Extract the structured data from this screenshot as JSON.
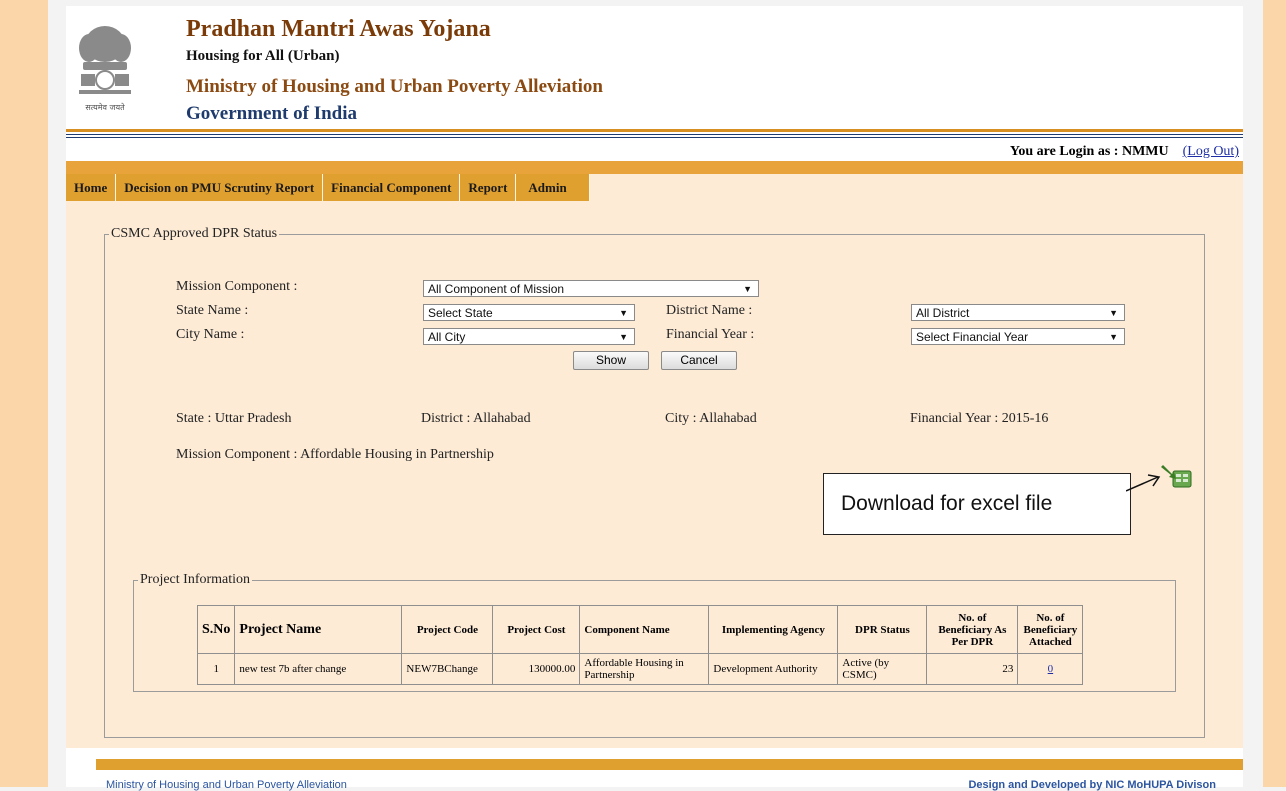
{
  "header": {
    "title": "Pradhan Mantri Awas Yojana",
    "subtitle": "Housing for All (Urban)",
    "ministry": "Ministry of Housing and Urban Poverty Alleviation",
    "government": "Government of India",
    "emblem_motto": "सत्यमेव जयते"
  },
  "user": {
    "login_text": "You are Login as : NMMU",
    "logout_label": "(Log Out)"
  },
  "menu": [
    {
      "label": "Home"
    },
    {
      "label": "Decision on PMU Scrutiny Report"
    },
    {
      "label": "Financial Component"
    },
    {
      "label": "Report"
    },
    {
      "label": "Admin"
    }
  ],
  "form": {
    "legend": "CSMC Approved DPR Status",
    "mission_component_label": "Mission Component :",
    "mission_component_value": "All Component of Mission",
    "state_label": "State Name :",
    "state_value": "Select State",
    "district_label": "District Name :",
    "district_value": "All District",
    "city_label": "City Name :",
    "city_value": "All City",
    "year_label": "Financial Year :",
    "year_value": "Select Financial Year",
    "show_label": "Show",
    "cancel_label": "Cancel"
  },
  "summary": {
    "state": "State : Uttar Pradesh",
    "district": "District : Allahabad",
    "city": "City : Allahabad",
    "year": "Financial Year : 2015-16",
    "mission": "Mission Component : Affordable Housing in Partnership"
  },
  "callout": {
    "text": "Download for excel file"
  },
  "project": {
    "legend": "Project Information",
    "columns": [
      "S.No",
      "Project Name",
      "Project Code",
      "Project Cost",
      "Component Name",
      "Implementing Agency",
      "DPR Status",
      "No. of Beneficiary As Per DPR",
      "No. of Beneficiary Attached"
    ],
    "rows": [
      {
        "sno": "1",
        "name": "new test 7b after change",
        "code": "NEW7BChange",
        "cost": "130000.00",
        "component": "Affordable Housing in Partnership",
        "agency": "Development Authority",
        "status": "Active (by CSMC)",
        "ben_dpr": "23",
        "ben_attached": "0"
      }
    ]
  },
  "footer": {
    "left": "Ministry of Housing and Urban Poverty Alleviation",
    "right": "Design and Developed by NIC MoHUPA Divison"
  },
  "colors": {
    "side_panel": "#fbd6a8",
    "menu_bar": "#e0a030",
    "content_bg": "#fdebd6",
    "title_brown": "#7a3b08",
    "link_blue": "#1e2ea6"
  }
}
